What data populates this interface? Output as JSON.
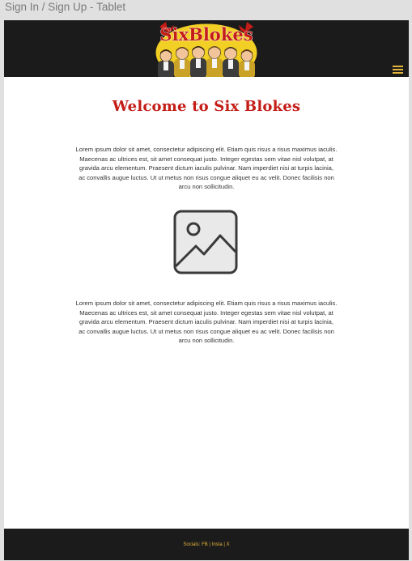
{
  "frame": {
    "title": "Sign In / Sign Up - Tablet"
  },
  "header": {
    "logo_text": "SixBlokes",
    "menu_icon": "hamburger-menu-icon"
  },
  "main": {
    "title": "Welcome to Six Blokes",
    "paragraph_1": "Lorem ipsum dolor sit amet, consectetur adipiscing elit. Etiam quis risus a risus maximus iaculis. Maecenas ac ultrices est, sit amet consequat justo. Integer egestas sem vitae nisl volutpat, at gravida arcu elementum. Praesent dictum iaculis pulvinar. Nam imperdiet nisi at turpis lacinia, ac convallis augue luctus. Ut ut metus non risus congue aliquet eu ac velit. Donec facilisis non arcu non sollicitudin.",
    "image_icon": "image-placeholder-icon",
    "paragraph_2": "Lorem ipsum dolor sit amet, consectetur adipiscing elit. Etiam quis risus a risus maximus iaculis. Maecenas ac ultrices est, sit amet consequat justo. Integer egestas sem vitae nisl volutpat, at gravida arcu elementum. Praesent dictum iaculis pulvinar. Nam imperdiet nisi at turpis lacinia, ac convallis augue luctus. Ut ut metus non risus congue aliquet eu ac velit. Donec facilisis non arcu non sollicitudin."
  },
  "footer": {
    "socials_label": "Socials:",
    "links": [
      "FB",
      "Insta",
      "X"
    ],
    "separator": "|"
  },
  "colors": {
    "header_bg": "#1b1b1b",
    "title_red": "#c41c16",
    "accent_gold": "#e3b43a",
    "logo_yellow": "#f2cf24"
  }
}
